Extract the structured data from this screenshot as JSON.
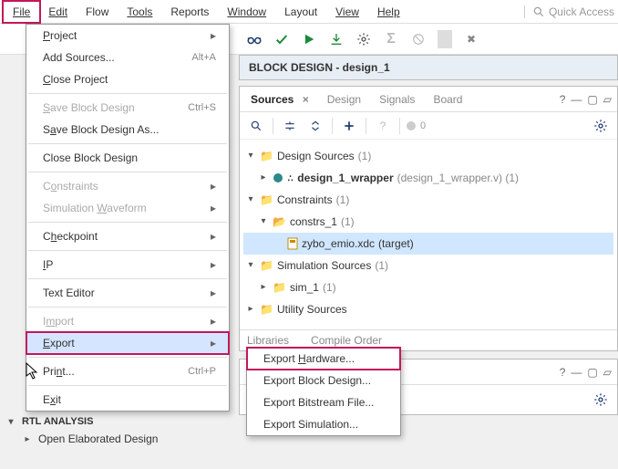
{
  "menubar": {
    "file": "File",
    "edit": "Edit",
    "flow": "Flow",
    "tools": "Tools",
    "reports": "Reports",
    "window": "Window",
    "layout": "Layout",
    "view": "View",
    "help": "Help",
    "quick_access": "Quick Access"
  },
  "file_menu": {
    "project": "Project",
    "add_sources": "Add Sources...",
    "add_sources_accel": "Alt+A",
    "close_project": "Close Project",
    "save_block": "Save Block Design",
    "save_block_accel": "Ctrl+S",
    "save_block_as": "Save Block Design As...",
    "close_block": "Close Block Design",
    "constraints": "Constraints",
    "sim_waveform": "Simulation Waveform",
    "checkpoint": "Checkpoint",
    "ip": "IP",
    "text_editor": "Text Editor",
    "import": "Import",
    "export": "Export",
    "print": "Print...",
    "print_accel": "Ctrl+P",
    "exit": "Exit"
  },
  "export_menu": {
    "hardware": "Export Hardware...",
    "block": "Export Block Design...",
    "bitstream": "Export Bitstream File...",
    "simulation": "Export Simulation..."
  },
  "design_header": "BLOCK DESIGN - design_1",
  "sources_panel": {
    "tabs": {
      "sources": "Sources",
      "design": "Design",
      "signals": "Signals",
      "board": "Board"
    },
    "toolbar_count": "0",
    "tree": {
      "design_sources": "Design Sources",
      "design_sources_count": "(1)",
      "wrapper_name": "design_1_wrapper",
      "wrapper_file": "(design_1_wrapper.v) (1)",
      "constraints": "Constraints",
      "constraints_count": "(1)",
      "constrs1": "constrs_1",
      "constrs1_count": "(1)",
      "xdc_name": "zybo_emio.xdc",
      "xdc_suffix": "(target)",
      "sim_sources": "Simulation Sources",
      "sim_sources_count": "(1)",
      "sim1": "sim_1",
      "sim1_count": "(1)",
      "utility": "Utility Sources"
    },
    "subtabs": {
      "libraries": "Libraries",
      "compile": "Compile Order"
    }
  },
  "left_reveal": {
    "header": "RTL ANALYSIS",
    "item": "Open Elaborated Design"
  }
}
